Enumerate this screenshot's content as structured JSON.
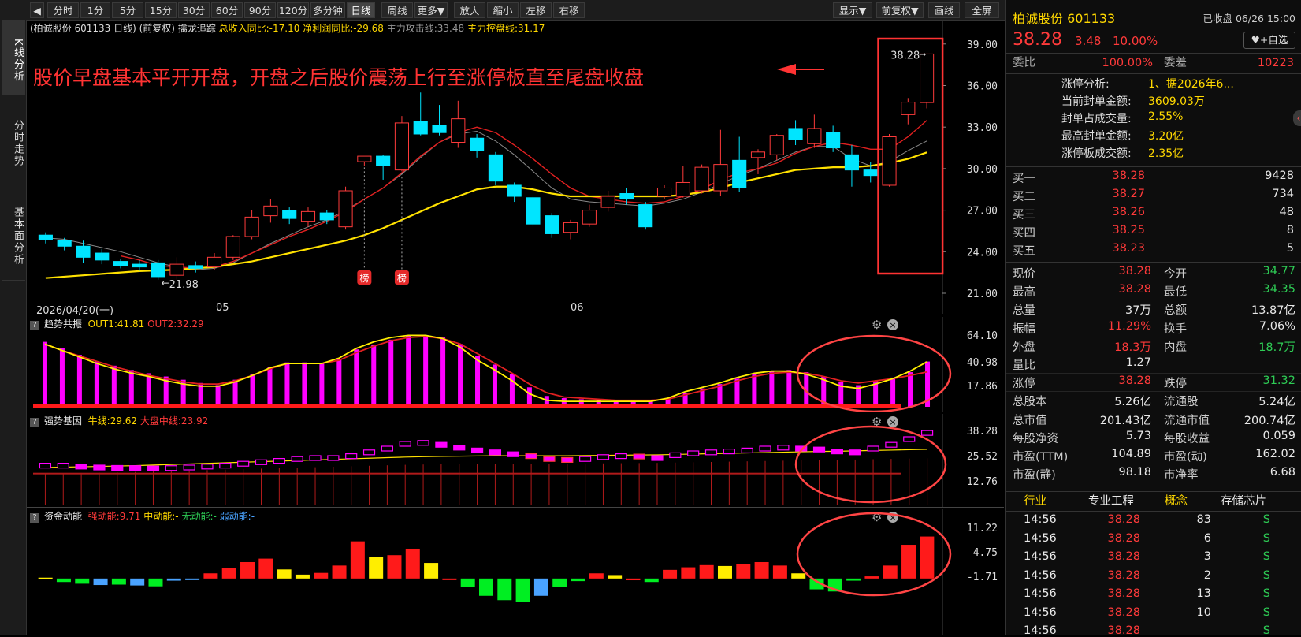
{
  "toolbar": {
    "items": [
      "分时",
      "1分",
      "5分",
      "15分",
      "30分",
      "60分",
      "90分",
      "120分",
      "多分钟",
      "日线",
      "周线",
      "更多▼",
      "放大",
      "缩小",
      "左移",
      "右移"
    ],
    "right": [
      "显示▼",
      "前复权▼",
      "画线",
      "全屏"
    ],
    "active": "日线"
  },
  "left_tabs": [
    "K线分析",
    "分时走势",
    "基本面分析"
  ],
  "main_chart": {
    "header": [
      "(柏诚股份 601133 日线)",
      "(前复权)",
      "擒龙追踪",
      "总收入同比:-17.10",
      "净利润同比:-29.68",
      "主力攻击线:33.48",
      "主力控盘线:31.17"
    ],
    "annotation": "股价早盘基本平开开盘，开盘之后股价震荡上行至涨停板直至尾盘收盘",
    "price_label": "38.28",
    "low_label": "21.98",
    "bang": "榜",
    "date_labels": [
      "2026/04/20(一)",
      "05",
      "06"
    ]
  },
  "indicator1": {
    "name": "趋势共振",
    "out1": "OUT1:41.81",
    "out2": "OUT2:32.29",
    "ticks": [
      "64.10",
      "40.98",
      "17.86"
    ]
  },
  "indicator2": {
    "name": "强势基因",
    "a": "牛线:29.62",
    "b": "大盘中线:23.92",
    "ticks": [
      "38.28",
      "25.52",
      "12.76"
    ]
  },
  "indicator3": {
    "name": "资金动能",
    "a": "强动能:9.71",
    "b": "中动能:-",
    "c": "无动能:-",
    "d": "弱动能:-",
    "ticks": [
      "11.22",
      "4.75",
      "-1.71"
    ]
  },
  "colors": {
    "up": "#ff3b3b",
    "down": "#00e5ff",
    "ma_yellow": "#ffe100",
    "ma_red": "#e02020",
    "magenta": "#ff00ff",
    "accent": "#ff3333"
  },
  "chart_data": {
    "type": "candlestick",
    "y_range": [
      21.0,
      39.5
    ],
    "y_ticks": [
      39.0,
      36.0,
      33.0,
      30.0,
      27.0,
      24.0,
      21.0
    ],
    "candles": [
      [
        25.2,
        24.9,
        25.4,
        24.6
      ],
      [
        24.8,
        24.4,
        25.0,
        24.1
      ],
      [
        24.4,
        23.6,
        24.8,
        23.2
      ],
      [
        23.9,
        23.4,
        24.2,
        23.1
      ],
      [
        23.3,
        23.0,
        23.5,
        22.8
      ],
      [
        23.1,
        22.9,
        23.4,
        22.6
      ],
      [
        23.2,
        22.2,
        23.4,
        21.98
      ],
      [
        22.3,
        23.1,
        23.6,
        22.0
      ],
      [
        23.0,
        22.8,
        23.3,
        22.5
      ],
      [
        22.9,
        23.6,
        23.9,
        22.7
      ],
      [
        23.6,
        25.1,
        25.2,
        23.4
      ],
      [
        25.1,
        26.5,
        27.0,
        24.9
      ],
      [
        26.6,
        27.3,
        27.8,
        26.1
      ],
      [
        27.0,
        26.4,
        27.2,
        26.0
      ],
      [
        26.2,
        26.9,
        27.2,
        25.8
      ],
      [
        26.8,
        26.3,
        27.0,
        26.0
      ],
      [
        25.8,
        28.4,
        28.7,
        25.6
      ],
      [
        30.5,
        30.9,
        30.9,
        30.2
      ],
      [
        30.9,
        30.2,
        31.0,
        29.2
      ],
      [
        29.9,
        33.3,
        33.8,
        29.8
      ],
      [
        33.4,
        32.5,
        35.5,
        32.4
      ],
      [
        33.1,
        32.6,
        34.6,
        32.4
      ],
      [
        31.9,
        33.6,
        34.9,
        31.5
      ],
      [
        32.2,
        31.3,
        32.5,
        30.8
      ],
      [
        31.0,
        29.1,
        31.2,
        28.8
      ],
      [
        28.8,
        28.0,
        29.0,
        27.6
      ],
      [
        27.9,
        26.0,
        28.1,
        25.8
      ],
      [
        26.6,
        25.3,
        26.8,
        25.0
      ],
      [
        25.4,
        26.1,
        26.3,
        24.9
      ],
      [
        26.0,
        27.0,
        27.4,
        25.8
      ],
      [
        27.2,
        28.0,
        28.4,
        26.9
      ],
      [
        28.2,
        27.8,
        28.6,
        27.4
      ],
      [
        27.4,
        25.8,
        27.6,
        25.6
      ],
      [
        28.0,
        28.6,
        28.8,
        27.8
      ],
      [
        28.0,
        29.0,
        30.2,
        27.9
      ],
      [
        28.4,
        30.1,
        30.3,
        28.2
      ],
      [
        28.4,
        30.3,
        32.8,
        28.0
      ],
      [
        30.6,
        28.6,
        32.3,
        28.3
      ],
      [
        30.8,
        31.2,
        31.4,
        29.6
      ],
      [
        31.0,
        32.4,
        32.5,
        30.6
      ],
      [
        32.9,
        32.1,
        33.5,
        31.7
      ],
      [
        31.8,
        32.9,
        33.9,
        31.5
      ],
      [
        32.6,
        31.5,
        33.1,
        31.2
      ],
      [
        31.0,
        29.9,
        31.7,
        28.7
      ],
      [
        29.9,
        29.5,
        30.5,
        29.0
      ],
      [
        28.8,
        32.3,
        32.5,
        28.7
      ],
      [
        33.9,
        34.8,
        35.1,
        33.2
      ],
      [
        34.77,
        38.28,
        38.28,
        34.35
      ]
    ],
    "ma_yellow": [
      22.1,
      22.2,
      22.3,
      22.4,
      22.5,
      22.6,
      22.65,
      22.7,
      22.8,
      22.9,
      23.1,
      23.3,
      23.6,
      23.9,
      24.2,
      24.5,
      24.8,
      25.2,
      25.7,
      26.3,
      26.9,
      27.5,
      28.0,
      28.5,
      28.7,
      28.7,
      28.5,
      28.2,
      28.0,
      28.0,
      28.0,
      28.0,
      28.0,
      28.0,
      28.1,
      28.3,
      28.6,
      29.0,
      29.3,
      29.6,
      29.9,
      30.0,
      30.1,
      30.1,
      30.2,
      30.4,
      30.7,
      31.17
    ],
    "ma_red": [
      null,
      null,
      null,
      null,
      23.7,
      23.4,
      23.0,
      22.9,
      22.8,
      22.9,
      23.3,
      23.9,
      24.5,
      25.1,
      25.6,
      26.2,
      26.9,
      27.8,
      28.6,
      29.7,
      30.9,
      31.9,
      32.6,
      33.0,
      32.6,
      31.7,
      30.7,
      29.6,
      28.6,
      28.0,
      27.8,
      27.6,
      27.5,
      27.6,
      28.0,
      28.5,
      29.2,
      29.7,
      30.0,
      30.4,
      31.1,
      31.6,
      31.9,
      31.7,
      31.4,
      31.4,
      32.3,
      33.48
    ],
    "ma_gray": [
      25.0,
      24.9,
      24.6,
      24.3,
      24.0,
      23.6,
      23.2,
      22.9,
      22.7,
      22.8,
      23.2,
      23.9,
      24.6,
      25.2,
      25.8,
      26.3,
      27.0,
      27.8,
      28.6,
      29.6,
      30.8,
      31.9,
      32.5,
      32.7,
      32.0,
      31.0,
      29.8,
      28.6,
      27.8,
      27.6,
      27.5,
      27.4,
      27.3,
      27.5,
      27.8,
      28.3,
      28.9,
      29.5,
      30.0,
      30.6,
      31.2,
      31.6,
      31.6,
      30.7,
      30.2,
      30.5,
      31.3,
      32.0
    ],
    "ind1": {
      "range": [
        0,
        67
      ],
      "bars": [
        60,
        54,
        48,
        42,
        38,
        34,
        31,
        28,
        25,
        22,
        20,
        25,
        30,
        37,
        41,
        41,
        40,
        44,
        53,
        57,
        62,
        66,
        66,
        64,
        58,
        47,
        39,
        30,
        18,
        10,
        8,
        7,
        6,
        6,
        6,
        6,
        8,
        13,
        17,
        21,
        26,
        30,
        33,
        34,
        32,
        28,
        23,
        20,
        24,
        27,
        32,
        41.81
      ],
      "out2_line": [
        58,
        52,
        47,
        42,
        37,
        33,
        29,
        26,
        23,
        21,
        21,
        24,
        29,
        35,
        40,
        40,
        40,
        43,
        50,
        56,
        61,
        64,
        65,
        63,
        58,
        49,
        40,
        31,
        21,
        13,
        9,
        8,
        7,
        6,
        6,
        6,
        7,
        11,
        15,
        19,
        24,
        28,
        31,
        32,
        31,
        28,
        24,
        22,
        24,
        26,
        29,
        32.29
      ],
      "out1_line": [
        58,
        52,
        46,
        40,
        35,
        31,
        28,
        24,
        21,
        19,
        19,
        23,
        29,
        36,
        40,
        40,
        40,
        45,
        54,
        60,
        64,
        66,
        66,
        63,
        55,
        43,
        34,
        24,
        12,
        6,
        5,
        5,
        5,
        5,
        5,
        5,
        8,
        14,
        18,
        22,
        27,
        31,
        33,
        33,
        30,
        25,
        19,
        17,
        21,
        26,
        33,
        41.81
      ]
    },
    "ind2": {
      "range": [
        0,
        40
      ],
      "vals": [
        21,
        21,
        20.5,
        20,
        19.8,
        19.7,
        19.5,
        19.7,
        20,
        20.5,
        21,
        22,
        22.8,
        23.5,
        24.5,
        25,
        25,
        26,
        28,
        30,
        32.5,
        33,
        32,
        30.5,
        29,
        28,
        27,
        26,
        24.5,
        24,
        24.5,
        25.5,
        26,
        25.8,
        25,
        26.5,
        27.5,
        28,
        28.5,
        29,
        30,
        30.5,
        30,
        29.5,
        28.5,
        28,
        30,
        32,
        35,
        38.28
      ],
      "lines": [
        20,
        20.2,
        20.4,
        20.6,
        20.8,
        21,
        21.3,
        21.6,
        21.9,
        22.2,
        22.5,
        22.8,
        23.1,
        23.4,
        23.7,
        24,
        24.3,
        24.6,
        24.9,
        25.2,
        25.5,
        25.7,
        25.9,
        26,
        26.1,
        26.2,
        26.2,
        26.2,
        26.2,
        26.2,
        26.3,
        26.4,
        26.5,
        26.6,
        26.7,
        26.9,
        27.1,
        27.3,
        27.5,
        27.7,
        27.9,
        28.1,
        28.3,
        28.5,
        28.6,
        28.8,
        29,
        29.2,
        29.4,
        29.62
      ]
    },
    "ind3": {
      "range": [
        -5.5,
        12
      ],
      "vals": [
        0.2,
        -0.8,
        -1.2,
        -1.5,
        -1.4,
        -1.6,
        -1.8,
        -0.5,
        -0.3,
        1.2,
        2.5,
        3.8,
        4.6,
        2.1,
        0.9,
        1.3,
        3.0,
        8.6,
        4.9,
        5.4,
        6.9,
        3.6,
        0.0,
        -2.0,
        -4.0,
        -5.0,
        -5.5,
        -4.0,
        -2.0,
        -0.6,
        1.2,
        0.8,
        -0.4,
        -0.8,
        2.0,
        2.6,
        3.1,
        2.9,
        3.4,
        3.8,
        3.0,
        1.2,
        -2.5,
        -3.0,
        -0.5,
        0.5,
        3.0,
        7.8,
        9.71
      ],
      "colors": [
        "y",
        "g",
        "g",
        "b",
        "g",
        "b",
        "g",
        "b",
        "b",
        "r",
        "r",
        "r",
        "r",
        "y",
        "y",
        "r",
        "r",
        "r",
        "y",
        "r",
        "r",
        "y",
        "r",
        "g",
        "g",
        "g",
        "g",
        "b",
        "g",
        "g",
        "r",
        "y",
        "r",
        "g",
        "r",
        "r",
        "r",
        "y",
        "r",
        "r",
        "r",
        "y",
        "g",
        "g",
        "g",
        "r",
        "r",
        "r",
        "r"
      ]
    }
  },
  "right_panel": {
    "name": "柏诚股份",
    "code": "601133",
    "status": "已收盘 06/26 15:00",
    "price": "38.28",
    "change": "3.48",
    "pct": "10.00%",
    "watch_btn": "+自选",
    "weibi_label": "委比",
    "weibi": "100.00%",
    "weicha_label": "委差",
    "weicha": "10223",
    "limit": [
      [
        "涨停分析:",
        "1、据2026年6..."
      ],
      [
        "当前封单金额:",
        "3609.03万"
      ],
      [
        "封单占成交量:",
        "2.55%"
      ],
      [
        "最高封单金额:",
        "3.20亿"
      ],
      [
        "涨停板成交额:",
        "2.35亿"
      ]
    ],
    "bids": [
      [
        "买一",
        "38.28",
        "9428"
      ],
      [
        "买二",
        "38.27",
        "734"
      ],
      [
        "买三",
        "38.26",
        "48"
      ],
      [
        "买四",
        "38.25",
        "8"
      ],
      [
        "买五",
        "38.23",
        "5"
      ]
    ],
    "quote": [
      [
        "现价",
        "38.28",
        "r",
        "今开",
        "34.77",
        "g"
      ],
      [
        "最高",
        "38.28",
        "r",
        "最低",
        "34.35",
        "g"
      ],
      [
        "总量",
        "37万",
        "w",
        "总额",
        "13.87亿",
        "w"
      ],
      [
        "振幅",
        "11.29%",
        "r",
        "换手",
        "7.06%",
        "w"
      ],
      [
        "外盘",
        "18.3万",
        "r",
        "内盘",
        "18.7万",
        "g"
      ],
      [
        "量比",
        "1.27",
        "w",
        "",
        "",
        ""
      ],
      [
        "涨停",
        "38.28",
        "r",
        "跌停",
        "31.32",
        "g"
      ],
      [
        "总股本",
        "5.26亿",
        "w",
        "流通股",
        "5.24亿",
        "w"
      ],
      [
        "总市值",
        "201.43亿",
        "w",
        "流通市值",
        "200.74亿",
        "w"
      ],
      [
        "每股净资",
        "5.73",
        "w",
        "每股收益",
        "0.059",
        "w"
      ],
      [
        "市盈(TTM)",
        "104.89",
        "w",
        "市盈(动)",
        "162.02",
        "w"
      ],
      [
        "市盈(静)",
        "98.18",
        "w",
        "市净率",
        "6.68",
        "w"
      ]
    ],
    "industry": [
      "行业",
      "专业工程",
      "概念",
      "存储芯片"
    ],
    "ticks": [
      [
        "14:56",
        "38.28",
        "83",
        "S"
      ],
      [
        "14:56",
        "38.28",
        "6",
        "S"
      ],
      [
        "14:56",
        "38.28",
        "3",
        "S"
      ],
      [
        "14:56",
        "38.28",
        "2",
        "S"
      ],
      [
        "14:56",
        "38.28",
        "13",
        "S"
      ],
      [
        "14:56",
        "38.28",
        "10",
        "S"
      ],
      [
        "14:56",
        "38.28",
        "",
        "S"
      ]
    ]
  }
}
